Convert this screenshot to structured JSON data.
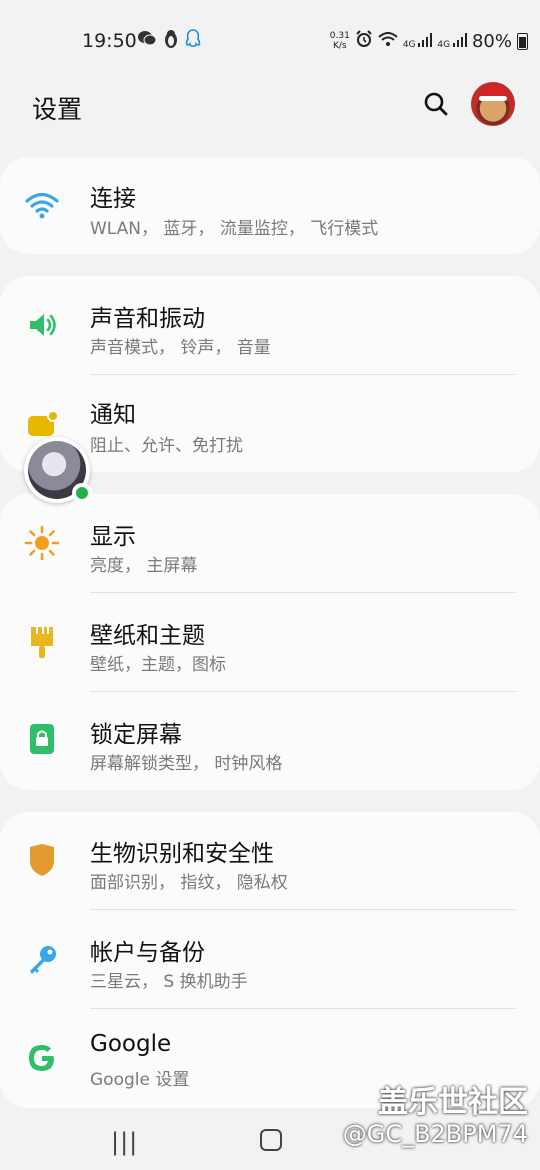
{
  "status_bar": {
    "time": "19:50",
    "left_icons": [
      "wechat-icon",
      "penguin-icon",
      "qq-icon"
    ],
    "net_speed_value": "0.31",
    "net_speed_unit": "K/s",
    "battery_percent": "80%",
    "signal_1": "4G",
    "signal_2": "4G"
  },
  "header": {
    "title": "设置"
  },
  "rows": {
    "connections": {
      "title": "连接",
      "sub": "WLAN， 蓝牙， 流量监控， 飞行模式",
      "icon": "wifi-icon",
      "color": "#3aa6e8"
    },
    "sound": {
      "title": "声音和振动",
      "sub": "声音模式， 铃声， 音量",
      "icon": "speaker-icon",
      "color": "#2fbf6a"
    },
    "notifications": {
      "title": "通知",
      "sub": "阻止、允许、免打扰",
      "icon": "notification-icon",
      "color": "#e6b800"
    },
    "display": {
      "title": "显示",
      "sub": "亮度， 主屏幕",
      "icon": "sun-icon",
      "color": "#f0a020"
    },
    "wallpaper": {
      "title": "壁纸和主题",
      "sub": "壁纸，主题，图标",
      "icon": "brush-icon",
      "color": "#e8b820"
    },
    "lockscreen": {
      "title": "锁定屏幕",
      "sub": "屏幕解锁类型， 时钟风格",
      "icon": "lock-icon",
      "color": "#2fbf6a"
    },
    "biometrics": {
      "title": "生物识别和安全性",
      "sub": "面部识别， 指纹， 隐私权",
      "icon": "shield-icon",
      "color": "#e39b30"
    },
    "accounts": {
      "title": "帐户与备份",
      "sub": "三星云， S 换机助手",
      "icon": "key-icon",
      "color": "#3aa6e8"
    },
    "google": {
      "title": "Google",
      "sub": "Google 设置",
      "icon": "google-icon",
      "color": "#2fbf6a"
    }
  },
  "watermark": {
    "site": "盖乐世社区",
    "user": "@GC_B2BPM74"
  }
}
